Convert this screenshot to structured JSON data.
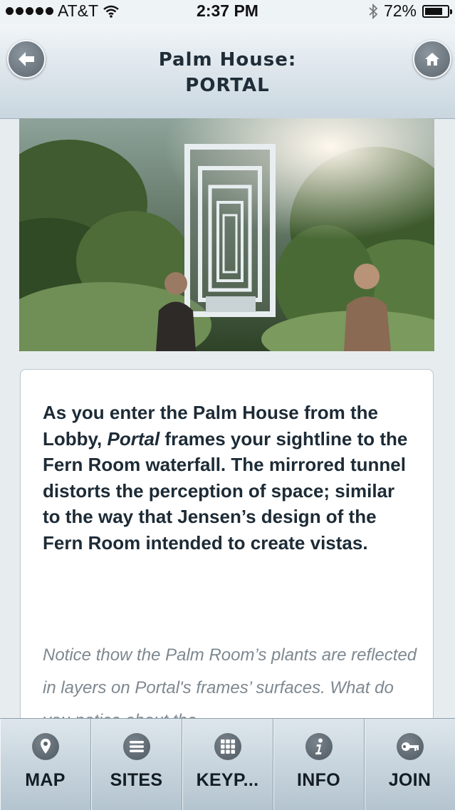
{
  "status_bar": {
    "carrier": "AT&T",
    "time": "2:37 PM",
    "battery": "72%"
  },
  "header": {
    "title_line1": "Palm House:",
    "title_line2": "PORTAL",
    "back_icon": "arrow-left-icon",
    "home_icon": "home-icon"
  },
  "hero_image": {
    "description_icon": "greenhouse-photo"
  },
  "content": {
    "lead_part1": "As you enter the Palm House from the Lobby, ",
    "lead_em": "Portal",
    "lead_part2": " frames your sightline to the Fern Room waterfall. The mirrored tunnel distorts the perception of space; similar to the way that Jensen’s design of the Fern Room intended to create vistas.",
    "note": "Notice thow the Palm Room’s plants are reflected in layers on Portal's frames’ surfaces. What do you notice about the"
  },
  "tabs": [
    {
      "label": "MAP",
      "icon": "map-pin-icon"
    },
    {
      "label": "SITES",
      "icon": "list-icon"
    },
    {
      "label": "KEYP...",
      "icon": "keypad-icon"
    },
    {
      "label": "INFO",
      "icon": "info-icon"
    },
    {
      "label": "JOIN",
      "icon": "key-icon"
    }
  ],
  "colors": {
    "header_top": "#f1f5f8",
    "header_bottom": "#c9d6df",
    "icon_button": "#5c666e",
    "text_dark": "#1d2b36",
    "text_muted": "#7e8890"
  }
}
